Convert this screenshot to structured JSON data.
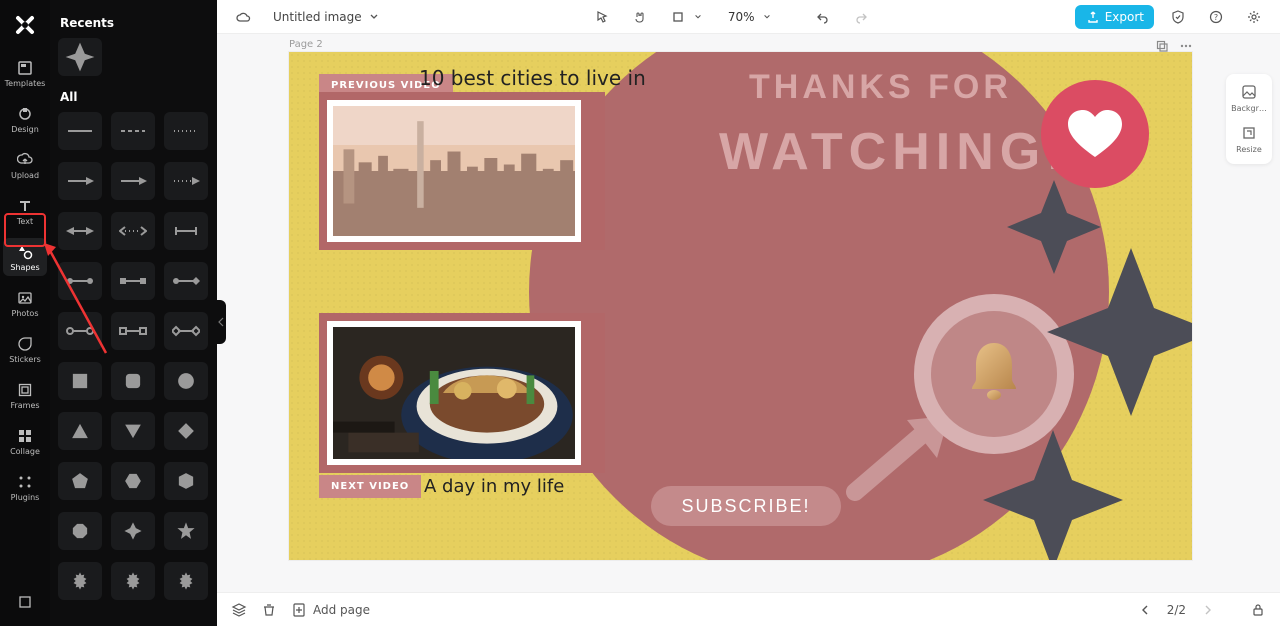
{
  "topbar": {
    "doc_title": "Untitled image",
    "zoom_label": "70%",
    "export_label": "Export"
  },
  "nav_rail": {
    "items": [
      {
        "id": "templates",
        "label": "Templates"
      },
      {
        "id": "design",
        "label": "Design"
      },
      {
        "id": "upload",
        "label": "Upload"
      },
      {
        "id": "text",
        "label": "Text"
      },
      {
        "id": "shapes",
        "label": "Shapes",
        "active": true
      },
      {
        "id": "photos",
        "label": "Photos"
      },
      {
        "id": "stickers",
        "label": "Stickers"
      },
      {
        "id": "frames",
        "label": "Frames"
      },
      {
        "id": "collage",
        "label": "Collage"
      },
      {
        "id": "plugins",
        "label": "Plugins"
      }
    ]
  },
  "panel": {
    "recents_label": "Recents",
    "all_label": "All"
  },
  "right_tools": {
    "background_label": "Backgr…",
    "resize_label": "Resize"
  },
  "canvas": {
    "page_label": "Page 2",
    "thanks_line1": "THANKS FOR",
    "thanks_line2": "WATCHING!",
    "prev_badge": "PREVIOUS VIDEO",
    "next_badge": "NEXT VIDEO",
    "caption1": "10 best cities to live in",
    "caption2": "A day in my life",
    "subscribe_label": "SUBSCRIBE!",
    "colors": {
      "bg": "#e6cf5e",
      "circle": "#b06a6b",
      "heart_bg": "#db4c63",
      "star": "#4c4d57"
    }
  },
  "bottombar": {
    "add_page_label": "Add page",
    "page_indicator": "2/2"
  }
}
